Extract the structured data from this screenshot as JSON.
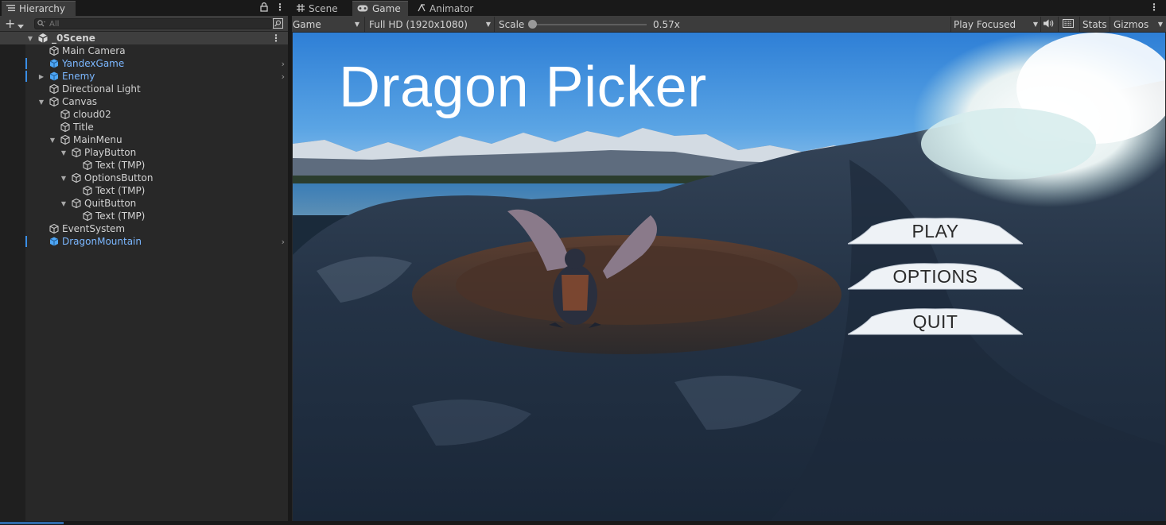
{
  "hierarchy": {
    "tab_title": "Hierarchy",
    "search_placeholder": "All",
    "items": [
      {
        "label": "_0Scene",
        "depth": 0,
        "expanded": true,
        "kind": "scene"
      },
      {
        "label": "Main Camera",
        "depth": 1,
        "kind": "object"
      },
      {
        "label": "YandexGame",
        "depth": 1,
        "kind": "prefab"
      },
      {
        "label": "Enemy",
        "depth": 1,
        "kind": "prefab",
        "collapsed": true
      },
      {
        "label": "Directional Light",
        "depth": 1,
        "kind": "object"
      },
      {
        "label": "Canvas",
        "depth": 1,
        "kind": "object",
        "expanded": true
      },
      {
        "label": "cloud02",
        "depth": 2,
        "kind": "object"
      },
      {
        "label": "Title",
        "depth": 2,
        "kind": "object"
      },
      {
        "label": "MainMenu",
        "depth": 2,
        "kind": "object",
        "expanded": true
      },
      {
        "label": "PlayButton",
        "depth": 3,
        "kind": "object",
        "expanded": true
      },
      {
        "label": "Text (TMP)",
        "depth": 4,
        "kind": "object"
      },
      {
        "label": "OptionsButton",
        "depth": 3,
        "kind": "object",
        "expanded": true
      },
      {
        "label": "Text (TMP)",
        "depth": 4,
        "kind": "object"
      },
      {
        "label": "QuitButton",
        "depth": 3,
        "kind": "object",
        "expanded": true
      },
      {
        "label": "Text (TMP)",
        "depth": 4,
        "kind": "object"
      },
      {
        "label": "EventSystem",
        "depth": 1,
        "kind": "object"
      },
      {
        "label": "DragonMountain",
        "depth": 1,
        "kind": "prefab"
      }
    ]
  },
  "tabs": {
    "scene": "Scene",
    "game": "Game",
    "animator": "Animator"
  },
  "toolbar": {
    "display": "Game",
    "resolution": "Full HD (1920x1080)",
    "scale_label": "Scale",
    "scale_value": "0.57x",
    "play_mode": "Play Focused",
    "stats": "Stats",
    "gizmos": "Gizmos"
  },
  "game": {
    "title": "Dragon Picker",
    "buttons": {
      "play": "PLAY",
      "options": "OPTIONS",
      "quit": "QUIT"
    }
  },
  "colors": {
    "prefab_text": "#7bb7ff",
    "selection_marker": "#3a8ee6",
    "panel_bg": "#282828",
    "toolbar_bg": "#3c3c3c"
  }
}
